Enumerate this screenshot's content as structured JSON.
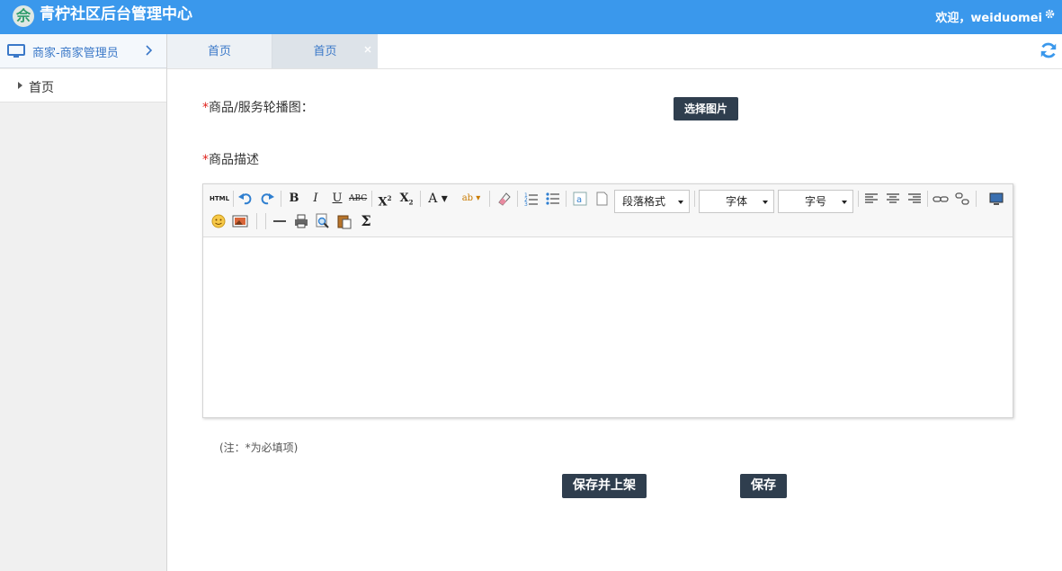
{
  "header": {
    "logo_glyph": "佘",
    "title": "青柠社区后台管理中心",
    "welcome": "欢迎，weiduomei",
    "bg_color": "#3a98ec"
  },
  "sidebar": {
    "heading": "商家-商家管理员",
    "items": [
      {
        "label": "首页"
      }
    ]
  },
  "tabs": [
    {
      "label": "首页",
      "closable": false
    },
    {
      "label": "首页",
      "closable": true,
      "active": true
    }
  ],
  "form": {
    "carousel": {
      "required_mark": "*",
      "label": "商品/服务轮播图：",
      "button": "选择图片"
    },
    "description": {
      "required_mark": "*",
      "label": "商品描述"
    },
    "editor": {
      "html_label": "HTML",
      "paragraph_select": "段落格式",
      "font_select": "字体",
      "size_select": "字号",
      "content": ""
    },
    "note": "(注：*为必填项)",
    "save_publish_button": "保存并上架",
    "save_button": "保存"
  },
  "colors": {
    "accent": "#3a98ec",
    "button_dark": "#2f3e4e",
    "required": "#e0231c"
  }
}
